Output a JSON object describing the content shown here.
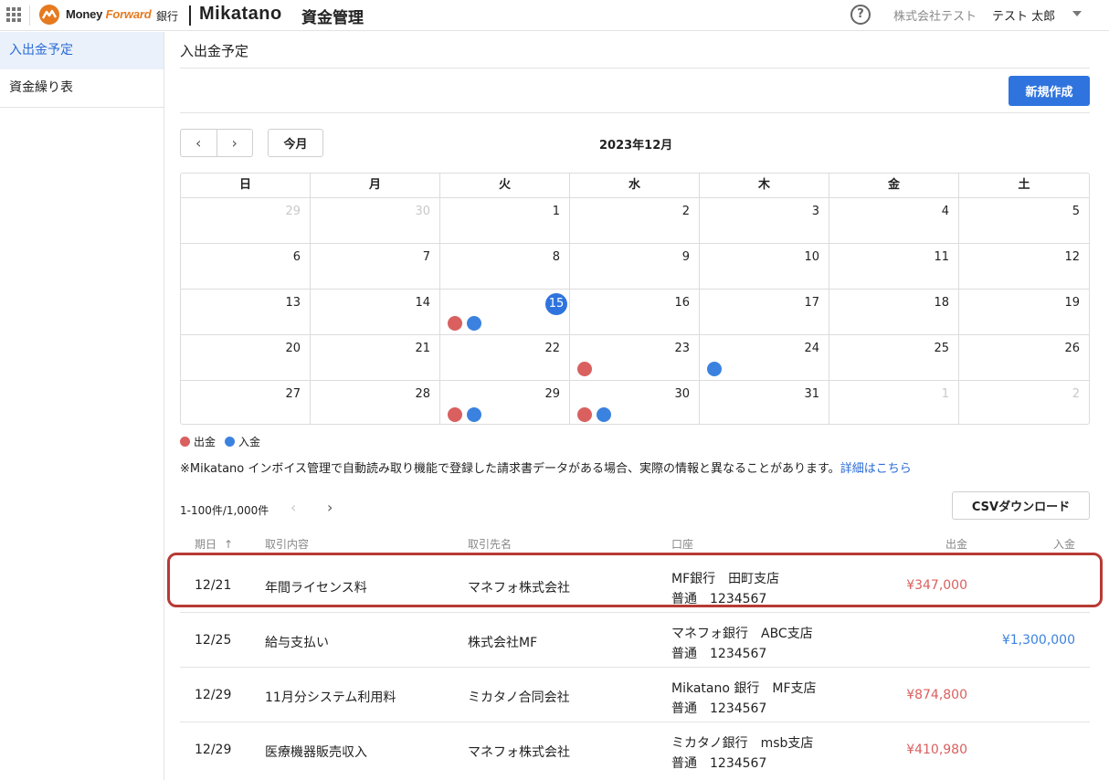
{
  "header": {
    "brand_money": "Money",
    "brand_forward": "Forward",
    "brand_bank": "銀行",
    "app_name": "Mikatano",
    "app_sub": "資金管理",
    "help": "?",
    "company": "株式会社テスト",
    "user": "テスト 太郎"
  },
  "sidebar": {
    "items": [
      {
        "label": "入出金予定",
        "active": true
      },
      {
        "label": "資金繰り表",
        "active": false
      }
    ]
  },
  "main": {
    "title": "入出金予定",
    "new_button": "新規作成",
    "today_button": "今月",
    "prev": "‹",
    "next": "›",
    "month": "2023年12月"
  },
  "calendar": {
    "weekdays": [
      "日",
      "月",
      "火",
      "水",
      "木",
      "金",
      "土"
    ],
    "weeks": [
      [
        {
          "d": "29",
          "m": true
        },
        {
          "d": "30",
          "m": true
        },
        {
          "d": "1"
        },
        {
          "d": "2"
        },
        {
          "d": "3"
        },
        {
          "d": "4"
        },
        {
          "d": "5"
        }
      ],
      [
        {
          "d": "6"
        },
        {
          "d": "7"
        },
        {
          "d": "8"
        },
        {
          "d": "9"
        },
        {
          "d": "10"
        },
        {
          "d": "11"
        },
        {
          "d": "12"
        }
      ],
      [
        {
          "d": "13"
        },
        {
          "d": "14"
        },
        {
          "d": "15",
          "today": true,
          "dots": [
            "out",
            "in"
          ]
        },
        {
          "d": "16"
        },
        {
          "d": "17"
        },
        {
          "d": "18"
        },
        {
          "d": "19"
        }
      ],
      [
        {
          "d": "20"
        },
        {
          "d": "21"
        },
        {
          "d": "22"
        },
        {
          "d": "23",
          "dots": [
            "out"
          ]
        },
        {
          "d": "24",
          "dots": [
            "in"
          ]
        },
        {
          "d": "25"
        },
        {
          "d": "26"
        }
      ],
      [
        {
          "d": "27"
        },
        {
          "d": "28"
        },
        {
          "d": "29",
          "dots": [
            "out",
            "in"
          ]
        },
        {
          "d": "30",
          "dots": [
            "out",
            "in"
          ]
        },
        {
          "d": "31"
        },
        {
          "d": "1",
          "m": true
        },
        {
          "d": "2",
          "m": true
        }
      ]
    ]
  },
  "legend": {
    "out": "出金",
    "in": "入金"
  },
  "notice": {
    "text": "※Mikatano インボイス管理で自動読み取り機能で登録した請求書データがある場合、実際の情報と異なることがあります。",
    "link": "詳細はこちら"
  },
  "pager": {
    "count": "1-100件/1,000件",
    "prev": "‹",
    "next": "›"
  },
  "csv_button": "CSVダウンロード",
  "table": {
    "headers": {
      "date": "期日",
      "sort": "↑",
      "desc": "取引内容",
      "party": "取引先名",
      "account": "口座",
      "out": "出金",
      "in": "入金"
    },
    "rows": [
      {
        "date": "12/21",
        "desc": "年間ライセンス料",
        "party": "マネフォ株式会社",
        "acct1": "MF銀行　田町支店",
        "acct2": "普通　1234567",
        "out": "¥347,000",
        "in": ""
      },
      {
        "date": "12/25",
        "desc": "給与支払い",
        "party": "株式会社MF",
        "acct1": "マネフォ銀行　ABC支店",
        "acct2": "普通　1234567",
        "out": "",
        "in": "¥1,300,000"
      },
      {
        "date": "12/29",
        "desc": "11月分システム利用料",
        "party": "ミカタノ合同会社",
        "acct1": "Mikatano 銀行　MF支店",
        "acct2": "普通　1234567",
        "out": "¥874,800",
        "in": ""
      },
      {
        "date": "12/29",
        "desc": "医療機器販売収入",
        "party": "マネフォ株式会社",
        "acct1": "ミカタノ銀行　msb支店",
        "acct2": "普通　1234567",
        "out": "¥410,980",
        "in": ""
      }
    ]
  },
  "colors": {
    "accent": "#2f74de",
    "out": "#d9605f",
    "in": "#3b82e0",
    "highlight": "#b83a35"
  }
}
